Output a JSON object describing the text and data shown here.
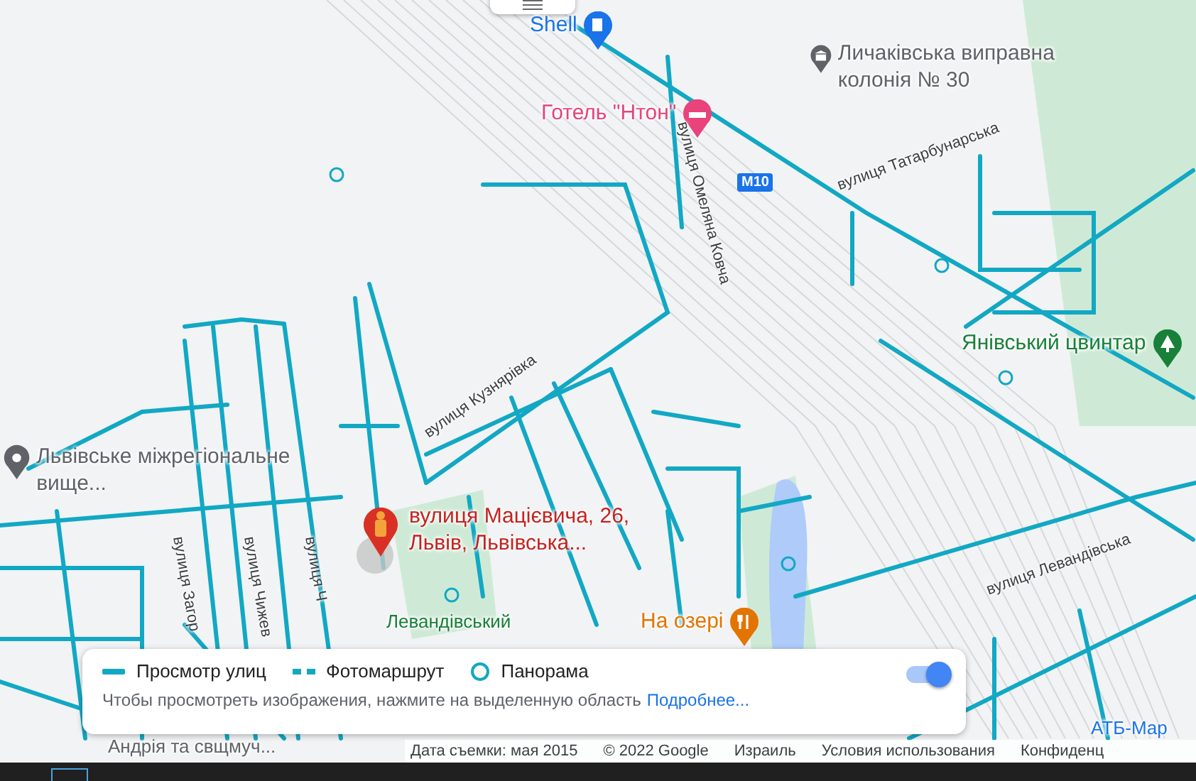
{
  "map": {
    "labels": [
      {
        "kind": "poi",
        "text": "Shell",
        "color": "#1a73e8"
      },
      {
        "kind": "poi",
        "text": "Личаківська виправна колонія № 30",
        "color": "#5f6368"
      },
      {
        "kind": "poi",
        "text": "Готель \"Нтон\"",
        "color": "#e8437a"
      },
      {
        "kind": "shield",
        "text": "M10"
      },
      {
        "kind": "street",
        "text": "вулиця Омеляна Ковча"
      },
      {
        "kind": "street",
        "text": "вулиця Татарбунарська"
      },
      {
        "kind": "poi",
        "text": "Янівський цвинтар",
        "color": "#188038"
      },
      {
        "kind": "street",
        "text": "вулиця Кузнярівка"
      },
      {
        "kind": "poi",
        "text": "Львівське міжрегіональне вище...",
        "color": "#5f6368"
      },
      {
        "kind": "address",
        "text": "вулиця Мацієвича, 26, Львів, Львівська..."
      },
      {
        "kind": "street",
        "text": "вулиця Загор"
      },
      {
        "kind": "street",
        "text": "вулиця Чижев"
      },
      {
        "kind": "street",
        "text": "вулиця Ч"
      },
      {
        "kind": "street",
        "text": "вулиця Левандівська"
      },
      {
        "kind": "place",
        "text": "Левандівський",
        "color": "#188038"
      },
      {
        "kind": "poi",
        "text": "На озері",
        "color": "#e37400"
      },
      {
        "kind": "place",
        "text": "Андрія та свщмуч...",
        "color": "#5f6368"
      },
      {
        "kind": "place",
        "text": "АТБ-Мар",
        "color": "#1a73e8"
      }
    ]
  },
  "legend": {
    "items": [
      {
        "kind": "line",
        "label": "Просмотр улиц"
      },
      {
        "kind": "dotted",
        "label": "Фотомаршрут"
      },
      {
        "kind": "circle",
        "label": "Панорама"
      }
    ],
    "hint": "Чтобы просмотреть изображения, нажмите на выделенную область",
    "link": "Подробнее...",
    "toggle": {
      "on": true
    }
  },
  "attribution": [
    "Дата съемки: мая 2015",
    "© 2022 Google",
    "Израиль",
    "Условия использования",
    "Конфиденц"
  ]
}
